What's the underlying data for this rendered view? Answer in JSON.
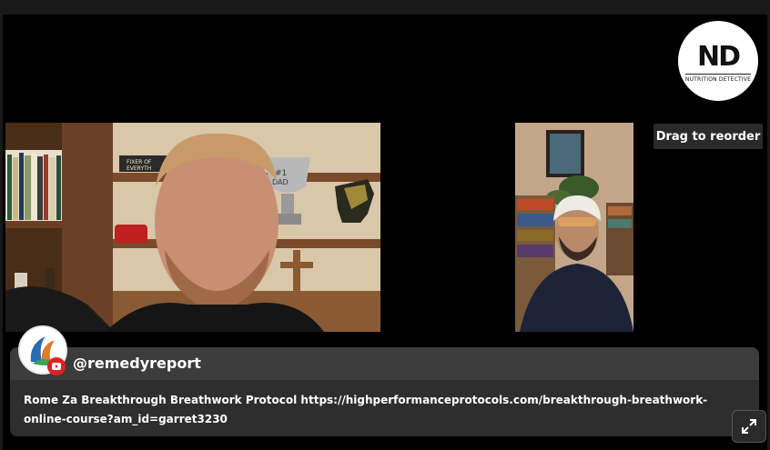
{
  "logo": {
    "mark_text": "ND",
    "sub_text": "NUTRITION DETECTIVE"
  },
  "tooltip": {
    "drag_label": "Drag to reorder"
  },
  "chat": {
    "handle": "@remedyreport",
    "message": "Rome Za Breakthrough Breathwork Protocol https://highperformanceprotocols.com/breakthrough-breathwork-online-course?am_id=garret3230",
    "platform_icon": "youtube-icon"
  },
  "scene": {
    "host_shelf_sign": "FIXER OF EVERYTHING",
    "host_trophy_text": "#1 DAD"
  },
  "colors": {
    "background": "#000000",
    "chat_header": "#3c3c3c",
    "chat_body": "#2e2e2e",
    "youtube_red": "#e02020"
  }
}
